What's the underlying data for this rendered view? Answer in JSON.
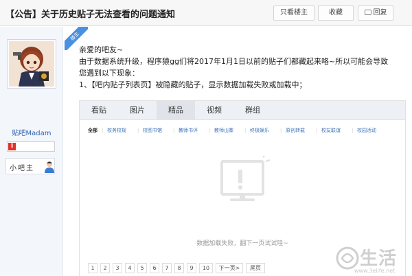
{
  "header": {
    "title": "【公告】关于历史贴子无法查看的问题通知",
    "buttons": {
      "only_op": "只看楼主",
      "favorite": "收藏",
      "reply": "回复"
    }
  },
  "author": {
    "name": "贴吧Madam",
    "role": "小吧主",
    "level_icon": "I"
  },
  "ribbon": "楼主",
  "content": {
    "greeting": "亲爱的吧友~",
    "line1": "由于数据系统升级，程序猿gg们将2017年1月1日以前的贴子们都藏起来咯~所以可能会导致",
    "line2": "您遇到以下现象：",
    "line3": "1、【吧内贴子列表页】被隐藏的贴子，显示数据加载失败或加载中；"
  },
  "embed": {
    "tabs": [
      "看贴",
      "图片",
      "精品",
      "视频",
      "群组"
    ],
    "active_tab": "精品",
    "subnav": [
      "全部",
      "校务校规",
      "校图书馆",
      "教师书评",
      "教师山寨",
      "终极娱乐",
      "原创转载",
      "校友联谊",
      "校园活动"
    ],
    "empty_message": "数据加载失败，翻下一页试试哇~",
    "pager": [
      "1",
      "2",
      "3",
      "4",
      "5",
      "6",
      "7",
      "8",
      "9",
      "10",
      "下一页>",
      "尾页"
    ]
  },
  "watermark": {
    "text": "生活",
    "url": "www.3elife.net"
  },
  "colors": {
    "link": "#2d64b3",
    "ribbon": "#4a90e2",
    "level": "#e0312b"
  }
}
